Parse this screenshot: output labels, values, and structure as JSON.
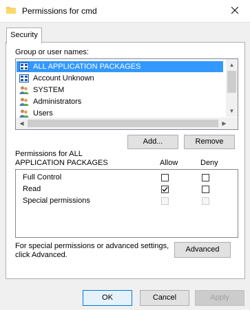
{
  "window": {
    "title": "Permissions for cmd"
  },
  "tabs": [
    {
      "label": "Security"
    }
  ],
  "group_section": {
    "label": "Group or user names:",
    "items": [
      {
        "label": "ALL APPLICATION PACKAGES",
        "icon": "app-packages-icon",
        "selected": true
      },
      {
        "label": "Account Unknown",
        "icon": "app-packages-icon",
        "selected": false
      },
      {
        "label": "SYSTEM",
        "icon": "users-icon",
        "selected": false
      },
      {
        "label": "Administrators",
        "icon": "users-icon",
        "selected": false
      },
      {
        "label": "Users",
        "icon": "users-icon",
        "selected": false
      }
    ]
  },
  "buttons": {
    "add": "Add...",
    "remove": "Remove",
    "advanced": "Advanced",
    "ok": "OK",
    "cancel": "Cancel",
    "apply": "Apply"
  },
  "permissions": {
    "label_line1": "Permissions for ALL",
    "label_line2": "APPLICATION PACKAGES",
    "allow_header": "Allow",
    "deny_header": "Deny",
    "rows": [
      {
        "name": "Full Control",
        "allow": false,
        "deny": false,
        "enabled": true
      },
      {
        "name": "Read",
        "allow": true,
        "deny": false,
        "enabled": true
      },
      {
        "name": "Special permissions",
        "allow": false,
        "deny": false,
        "enabled": false
      }
    ]
  },
  "advanced_note": {
    "line1": "For special permissions or advanced settings,",
    "line2": "click Advanced."
  },
  "colors": {
    "selection": "#3399ff",
    "accent": "#0078d7"
  }
}
